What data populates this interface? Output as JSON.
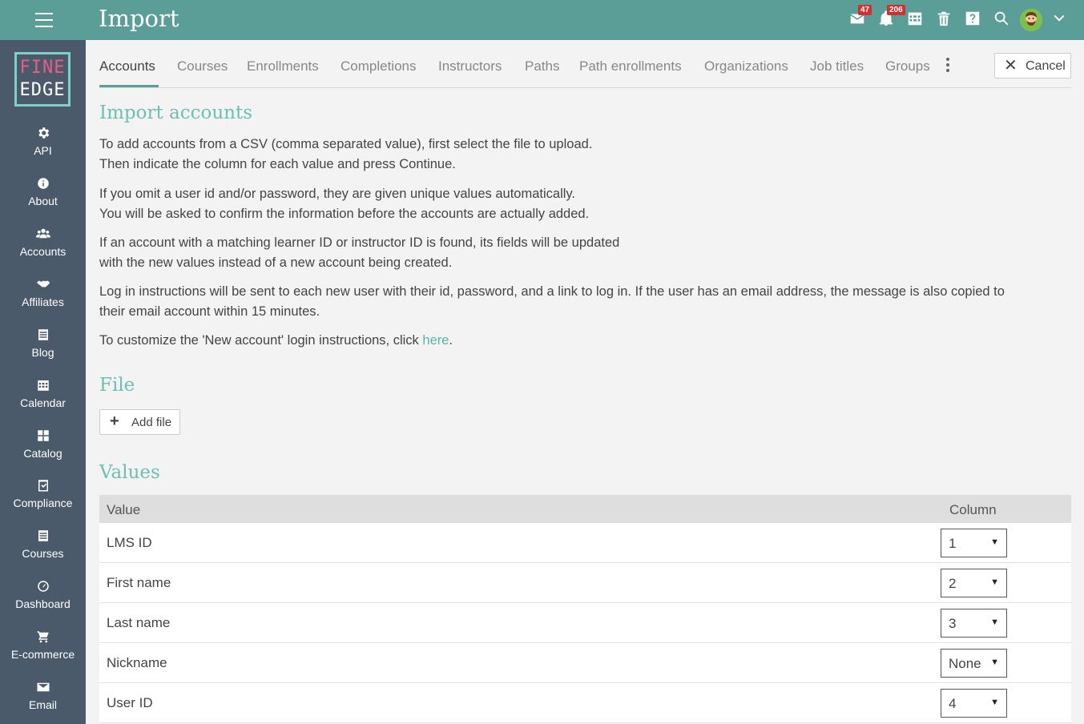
{
  "header": {
    "title": "Import",
    "menu_icon": "hamburger-icon",
    "mail_badge": "47",
    "notifications_badge": "206",
    "icons": [
      "mail-icon",
      "bell-icon",
      "calendar-icon",
      "trash-icon",
      "help-icon",
      "search-icon",
      "avatar",
      "chevron-down-icon"
    ]
  },
  "logo": {
    "line1": "FINE",
    "line2": "EDGE"
  },
  "sidebar": {
    "items": [
      {
        "label": "API",
        "icon": "gear-icon"
      },
      {
        "label": "About",
        "icon": "info-icon"
      },
      {
        "label": "Accounts",
        "icon": "users-icon"
      },
      {
        "label": "Affiliates",
        "icon": "handshake-icon"
      },
      {
        "label": "Blog",
        "icon": "blog-icon"
      },
      {
        "label": "Calendar",
        "icon": "calendar-icon"
      },
      {
        "label": "Catalog",
        "icon": "grid-icon"
      },
      {
        "label": "Compliance",
        "icon": "clipboard-check-icon"
      },
      {
        "label": "Courses",
        "icon": "courses-icon"
      },
      {
        "label": "Dashboard",
        "icon": "dashboard-icon"
      },
      {
        "label": "E-commerce",
        "icon": "cart-icon"
      },
      {
        "label": "Email",
        "icon": "envelope-icon"
      }
    ]
  },
  "tabs": [
    "Accounts",
    "Courses",
    "Enrollments",
    "Completions",
    "Instructors",
    "Paths",
    "Path enrollments",
    "Organizations",
    "Job titles",
    "Groups"
  ],
  "cancel_label": "Cancel",
  "import": {
    "heading": "Import accounts",
    "p1a": "To add accounts from a CSV (comma separated value), first select the file to upload.",
    "p1b": "Then indicate the column for each value and press Continue.",
    "p2a": "If you omit a user id and/or password, they are given unique values automatically.",
    "p2b": "You will be asked to confirm the information before the accounts are actually added.",
    "p3a": "If an account with a matching learner ID or instructor ID is found, its fields will be updated",
    "p3b": "with the new values instead of a new account being created.",
    "p4a": "Log in instructions will be sent to each new user with their id, password, and a link to log in. If the user has an email address, the message is also copied to",
    "p4b": "their email account within 15 minutes.",
    "p5_text": "To customize the 'New account' login instructions, click ",
    "p5_link": "here",
    "p5_end": "."
  },
  "file": {
    "heading": "File",
    "add_label": "Add file"
  },
  "values": {
    "heading": "Values",
    "col_value": "Value",
    "col_column": "Column",
    "rows": [
      {
        "label": "LMS ID",
        "column": "1"
      },
      {
        "label": "First name",
        "column": "2"
      },
      {
        "label": "Last name",
        "column": "3"
      },
      {
        "label": "Nickname",
        "column": "None"
      },
      {
        "label": "User ID",
        "column": "4"
      }
    ]
  }
}
